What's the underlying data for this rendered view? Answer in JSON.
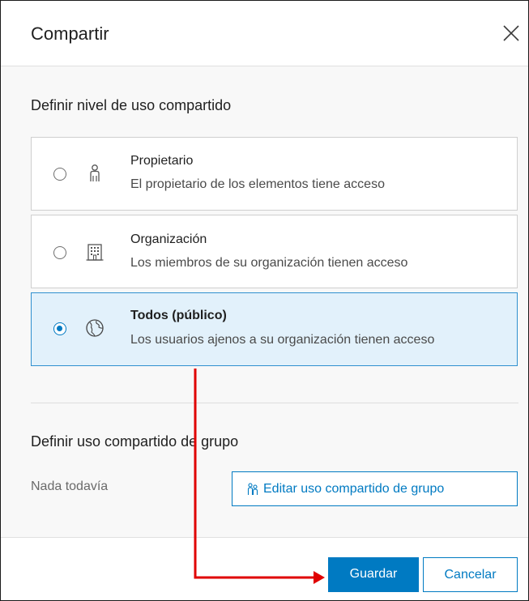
{
  "dialog": {
    "title": "Compartir"
  },
  "sharing_level": {
    "heading": "Definir nivel de uso compartido",
    "options": [
      {
        "title": "Propietario",
        "description": "El propietario de los elementos tiene acceso",
        "icon": "user-icon",
        "selected": false
      },
      {
        "title": "Organización",
        "description": "Los miembros de su organización tienen acceso",
        "icon": "building-icon",
        "selected": false
      },
      {
        "title": "Todos (público)",
        "description": "Los usuarios ajenos a su organización tienen acceso",
        "icon": "globe-icon",
        "selected": true
      }
    ]
  },
  "group_sharing": {
    "heading": "Definir uso compartido de grupo",
    "empty_text": "Nada todavía",
    "edit_button": "Editar uso compartido de grupo",
    "edit_icon": "group-users-icon"
  },
  "footer": {
    "save_label": "Guardar",
    "cancel_label": "Cancelar"
  },
  "colors": {
    "accent": "#007ac2",
    "selected_bg": "#e2f1fb",
    "annotation_arrow": "#e00000"
  }
}
